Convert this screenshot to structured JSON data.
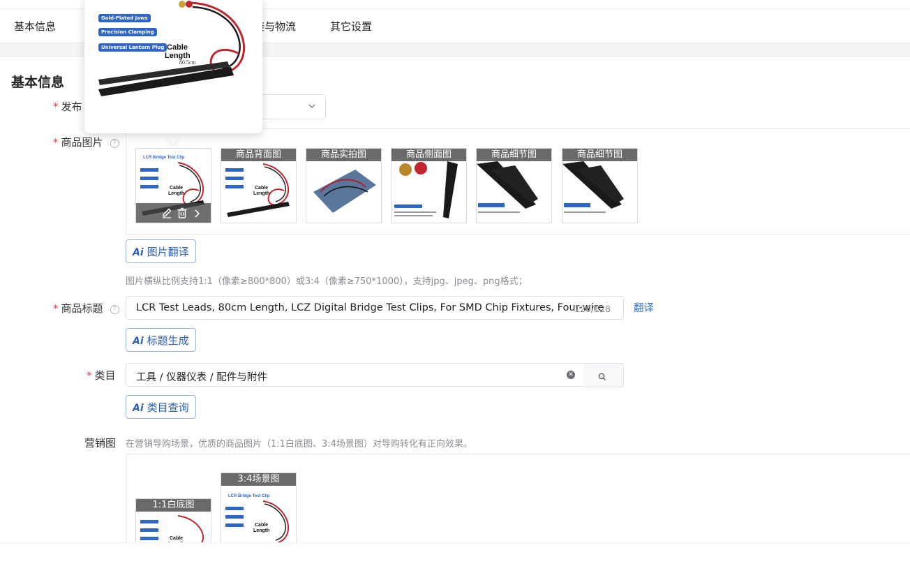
{
  "tabs": [
    "基本信息",
    "装与物流",
    "其它设置"
  ],
  "section": {
    "title": "基本信息"
  },
  "publish": {
    "label": "发布"
  },
  "images": {
    "label": "商品图片",
    "thumbs": [
      {
        "label": "",
        "variant": "main"
      },
      {
        "label": "商品背面图",
        "variant": "main"
      },
      {
        "label": "商品实拍图",
        "variant": "bag"
      },
      {
        "label": "商品侧面图",
        "variant": "side"
      },
      {
        "label": "商品细节图",
        "variant": "detail"
      },
      {
        "label": "商品细节图",
        "variant": "detail"
      }
    ],
    "translate_button": "图片翻译",
    "hint": "图片横纵比例支持1:1（像素≥800*800）或3:4（像素≥750*1000），支持jpg、jpeg、png格式；"
  },
  "title_field": {
    "label": "商品标题",
    "value": "LCR Test Leads, 80cm Length, LCZ Digital Bridge Test Clips, For SMD Chip Fixtures, Four-wire",
    "counter": "120/128",
    "translate_link": "翻译",
    "generate_button": "标题生成"
  },
  "category": {
    "label": "类目",
    "value": "工具 / 仪器仪表 / 配件与附件",
    "query_button": "类目查询"
  },
  "marketing": {
    "label": "营销图",
    "hint": "在营销导购场景，优质的商品图片（1:1白底图、3:4场景图）对导购转化有正向效果。",
    "thumbs": [
      {
        "label": "1:1白底图"
      },
      {
        "label": "3:4场景图"
      }
    ]
  },
  "popup": {
    "chips": [
      "Gold-Plated Jaws",
      "Precision Clamping",
      "Universal Lantern Plug"
    ],
    "cable_title": "Cable",
    "cable_sub": "Length",
    "cable_len": "80.5cm"
  },
  "thumb_text": {
    "brand": "LCR Bridge Test Clip",
    "cable": "Cable",
    "length": "Length"
  },
  "ai_mark": "Ai"
}
